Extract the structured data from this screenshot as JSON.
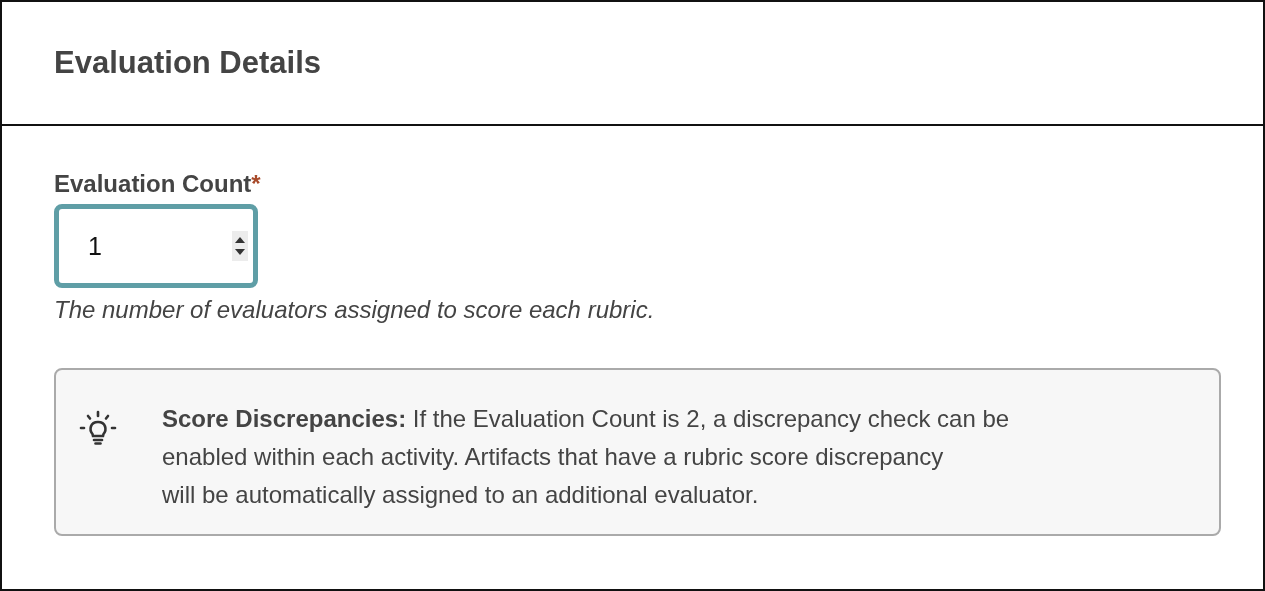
{
  "panel": {
    "title": "Evaluation Details"
  },
  "field": {
    "label": "Evaluation Count",
    "required_mark": "*",
    "value": "1",
    "focused": true,
    "help": "The number of evaluators assigned to score each rubric."
  },
  "callout": {
    "text": "**Score Discrepancies:** If the Evaluation Count is 2, a discrepancy check can be\nenabled within each activity. Artifacts that have a rubric score discrepancy\nwill be automatically assigned to an additional evaluator."
  }
}
